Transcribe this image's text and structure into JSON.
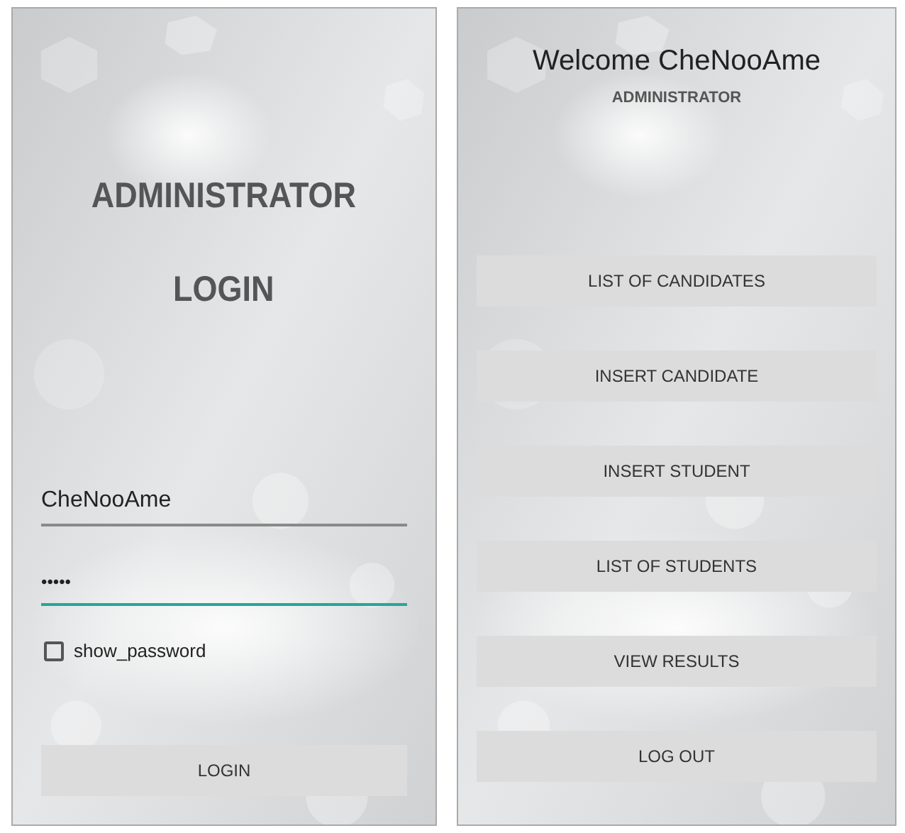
{
  "login_screen": {
    "title_lines": [
      "ADMINISTRATOR",
      "LOGIN"
    ],
    "username_field": {
      "value": "CheNooAme",
      "focused": false
    },
    "password_field": {
      "value": "•••••",
      "focused": true
    },
    "show_password": {
      "label": "show_password",
      "checked": false
    },
    "login_button": "LOGIN"
  },
  "menu_screen": {
    "welcome": "Welcome CheNooAme",
    "role": "ADMINISTRATOR",
    "buttons": [
      "LIST OF CANDIDATES",
      "INSERT CANDIDATE",
      "INSERT STUDENT",
      "LIST OF STUDENTS",
      "VIEW RESULTS",
      "LOG OUT"
    ]
  }
}
